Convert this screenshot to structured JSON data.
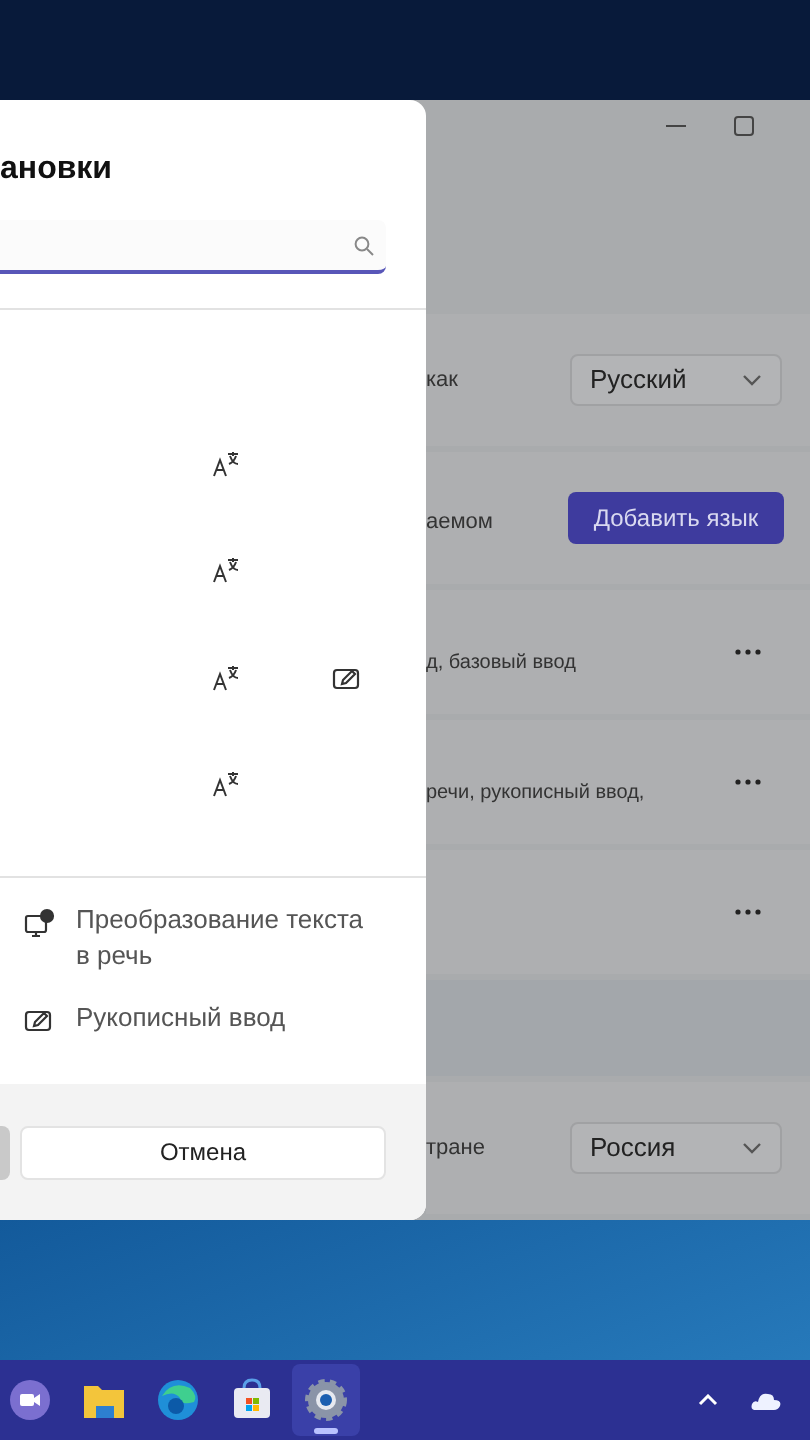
{
  "dialog": {
    "title": "ановки",
    "language_rows": [
      {
        "display_language": true,
        "handwriting": false
      },
      {
        "display_language": true,
        "handwriting": false
      },
      {
        "display_language": true,
        "handwriting": true
      },
      {
        "display_language": true,
        "handwriting": false
      }
    ],
    "features": [
      {
        "kind": "speech",
        "label": "Преобразование текста в речь"
      },
      {
        "kind": "handwriting",
        "label": "Рукописный ввод"
      }
    ],
    "cancel_button": "Отмена"
  },
  "settings": {
    "rows": [
      {
        "kind": "select",
        "label": "как",
        "value": "Русский"
      },
      {
        "kind": "button",
        "label": "аемом",
        "button": "Добавить язык"
      },
      {
        "kind": "language",
        "label": "д, базовый ввод"
      },
      {
        "kind": "language",
        "label": "речи, рукописный ввод,"
      },
      {
        "kind": "language",
        "label": ""
      },
      {
        "kind": "band"
      },
      {
        "kind": "select",
        "label": "тране",
        "value": "Россия"
      }
    ]
  },
  "taskbar": {
    "items": [
      {
        "kind": "meet",
        "selected": false
      },
      {
        "kind": "folder",
        "selected": false
      },
      {
        "kind": "edge",
        "selected": false
      },
      {
        "kind": "store",
        "selected": false
      },
      {
        "kind": "settings",
        "selected": true
      }
    ]
  }
}
